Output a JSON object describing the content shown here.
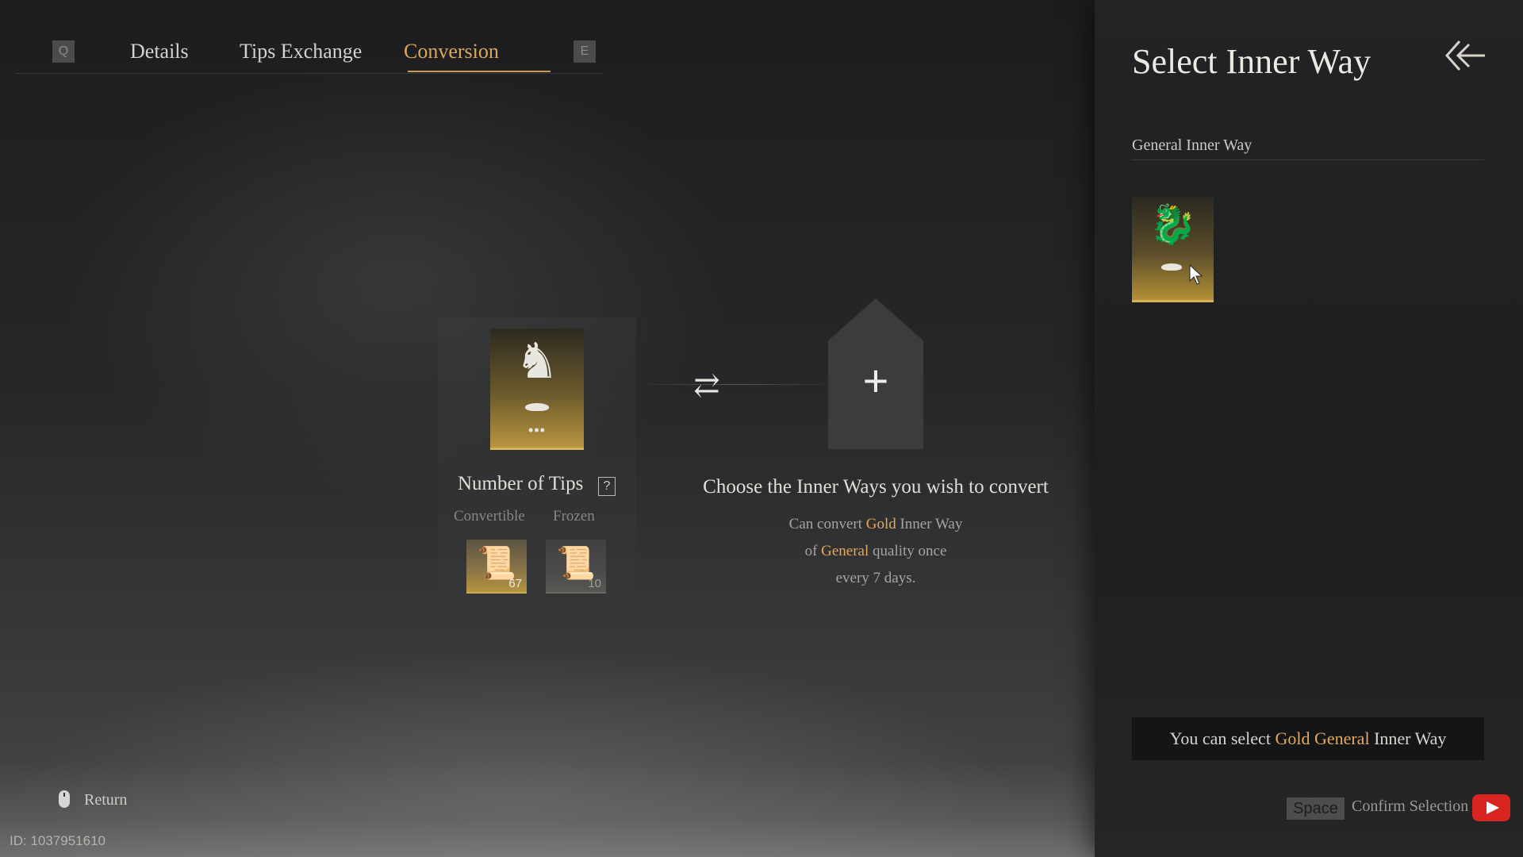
{
  "tabs": {
    "prev_key": "Q",
    "next_key": "E",
    "items": [
      "Details",
      "Tips Exchange",
      "Conversion"
    ],
    "active": "Conversion"
  },
  "current_inner_way": {
    "icon": "horse-icon",
    "dots": "•••"
  },
  "tips": {
    "title": "Number of Tips",
    "help": "?",
    "convertible_label": "Convertible",
    "frozen_label": "Frozen",
    "convertible_count": "67",
    "frozen_count": "10"
  },
  "conversion": {
    "title": "Choose the Inner Ways you wish to convert",
    "desc_1": "Can convert",
    "gold": "Gold",
    "desc_2": "Inner Way",
    "desc_3": "of",
    "general": "General",
    "desc_4": "quality once",
    "desc_5": "every 7 days.",
    "plus": "+"
  },
  "footer": {
    "return_label": "Return",
    "id_label": "ID: 1037951610"
  },
  "panel": {
    "title": "Select Inner Way",
    "section": "General Inner Way",
    "hint_prefix": "You can select",
    "hint_highlight": "Gold General",
    "hint_suffix": "Inner Way",
    "space_key": "Space",
    "confirm_label": "Confirm Selection"
  },
  "colors": {
    "accent_gold": "#d9a85c",
    "highlight": "#e3a958"
  }
}
